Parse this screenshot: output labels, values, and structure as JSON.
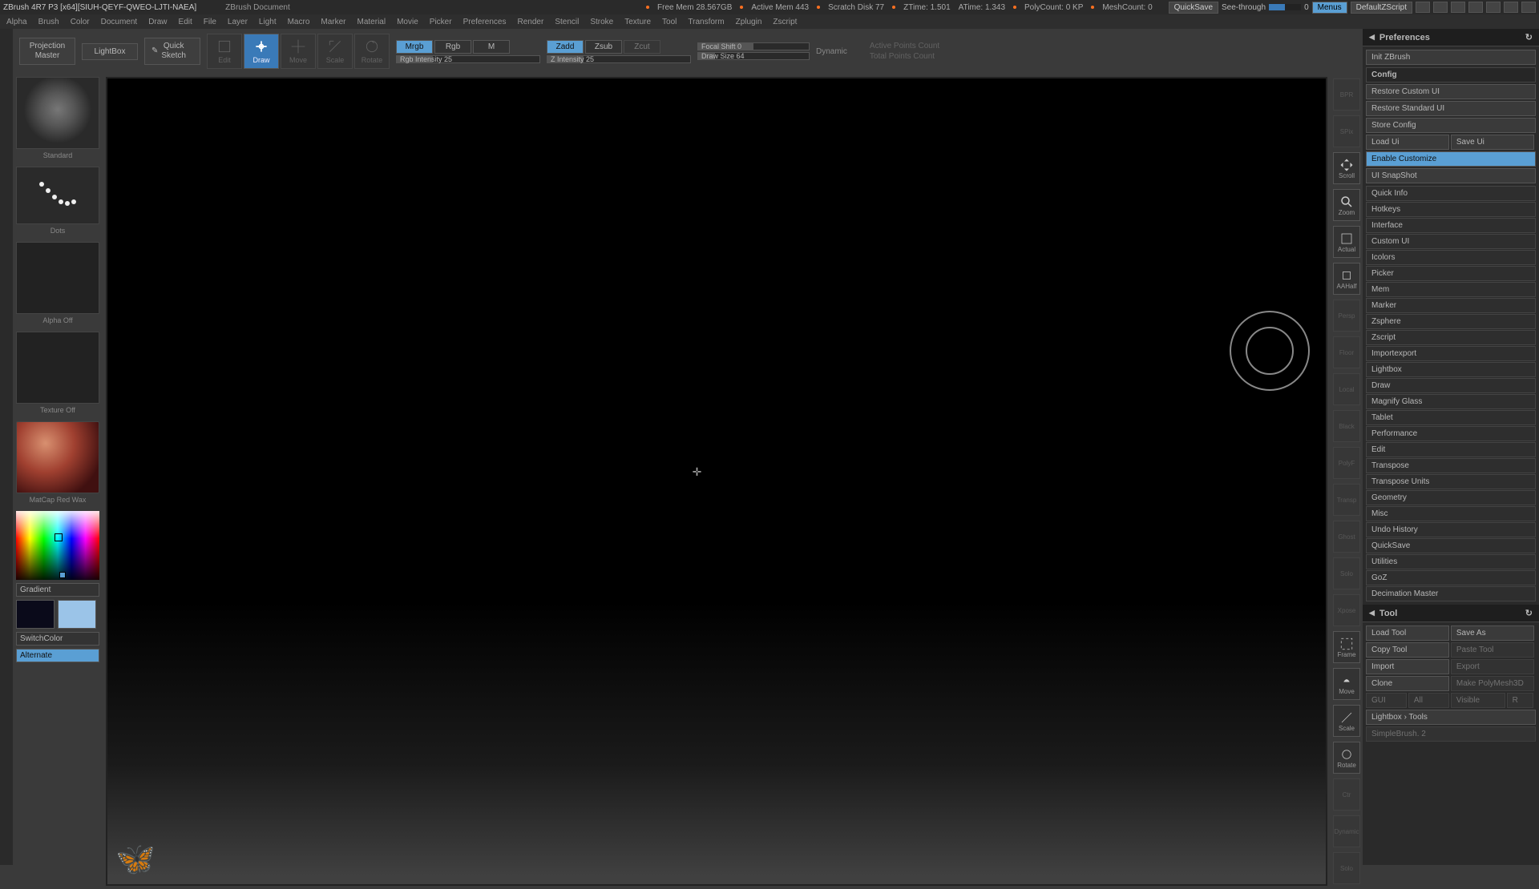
{
  "titlebar": {
    "title": "ZBrush 4R7 P3 [x64][SIUH-QEYF-QWEO-LJTI-NAEA]",
    "doc": "ZBrush Document",
    "stats": {
      "freemem": "Free Mem 28.567GB",
      "activemem": "Active Mem 443",
      "scratch": "Scratch Disk 77",
      "ztime": "ZTime: 1.501",
      "atime": "ATime: 1.343",
      "polycount": "PolyCount: 0 KP",
      "meshcount": "MeshCount: 0"
    },
    "quicksave": "QuickSave",
    "seethrough": "See-through",
    "seethrough_val": "0",
    "menus": "Menus",
    "script": "DefaultZScript"
  },
  "menubar": [
    "Alpha",
    "Brush",
    "Color",
    "Document",
    "Draw",
    "Edit",
    "File",
    "Layer",
    "Light",
    "Macro",
    "Marker",
    "Material",
    "Movie",
    "Picker",
    "Preferences",
    "Render",
    "Stencil",
    "Stroke",
    "Texture",
    "Tool",
    "Transform",
    "Zplugin",
    "Zscript"
  ],
  "left": {
    "projection": "Projection\nMaster",
    "lightbox": "LightBox",
    "quicksketch": "Quick\nSketch",
    "brush_cap": "Standard",
    "dots_cap": "Dots",
    "alpha_cap": "Alpha Off",
    "tex_cap": "Texture Off",
    "mat_cap": "MatCap Red Wax",
    "gradient": "Gradient",
    "switchcolor": "SwitchColor",
    "alternate": "Alternate"
  },
  "toolbar": {
    "modes": {
      "draw": "Draw",
      "move": "Move",
      "scale": "Scale",
      "rotate": "Rotate",
      "edit": "Edit"
    },
    "mrgb": "Mrgb",
    "rgb": "Rgb",
    "m": "M",
    "rgbint": "Rgb Intensity 25",
    "zadd": "Zadd",
    "zsub": "Zsub",
    "zcut": "Zcut",
    "zint": "Z Intensity 25",
    "focal": "Focal Shift 0",
    "drawsize": "Draw Size 64",
    "dynamic": "Dynamic",
    "active_pts": "Active Points Count",
    "total_pts": "Total Points Count"
  },
  "rtools": [
    "BPR",
    "SPix",
    "Scroll",
    "Zoom",
    "Actual",
    "AAHalf",
    "Persp",
    "Floor",
    "Local",
    "Black",
    "PolyF",
    "Transp",
    "Ghost",
    "Solo",
    "Xpose",
    "Frame",
    "Move",
    "Scale",
    "Rotate",
    "Ctr",
    "Dynamic",
    "Solo"
  ],
  "prefs": {
    "title": "Preferences",
    "init": "Init ZBrush",
    "config": "Config",
    "restore_custom": "Restore Custom UI",
    "restore_std": "Restore Standard UI",
    "store": "Store Config",
    "load_ui": "Load Ui",
    "save_ui": "Save Ui",
    "enable_custom": "Enable Customize",
    "snapshot": "UI SnapShot",
    "sections": [
      "Quick Info",
      "Hotkeys",
      "Interface",
      "Custom UI",
      "Icolors",
      "Picker",
      "Mem",
      "Marker",
      "Zsphere",
      "Zscript",
      "Importexport",
      "Lightbox",
      "Draw",
      "Magnify Glass",
      "Tablet",
      "Performance",
      "Edit",
      "Transpose",
      "Transpose Units",
      "Geometry",
      "Misc",
      "Undo History",
      "QuickSave",
      "Utilities",
      "GoZ",
      "Decimation Master"
    ]
  },
  "tool": {
    "title": "Tool",
    "load": "Load Tool",
    "saveas": "Save As",
    "copy": "Copy Tool",
    "paste": "Paste Tool",
    "import": "Import",
    "export": "Export",
    "clone": "Clone",
    "makepoly": "Make PolyMesh3D",
    "gui": "GUI",
    "all": "All",
    "visible": "Visible",
    "r": "R",
    "lightbox_tools": "Lightbox › Tools",
    "simple": "SimpleBrush. 2"
  }
}
